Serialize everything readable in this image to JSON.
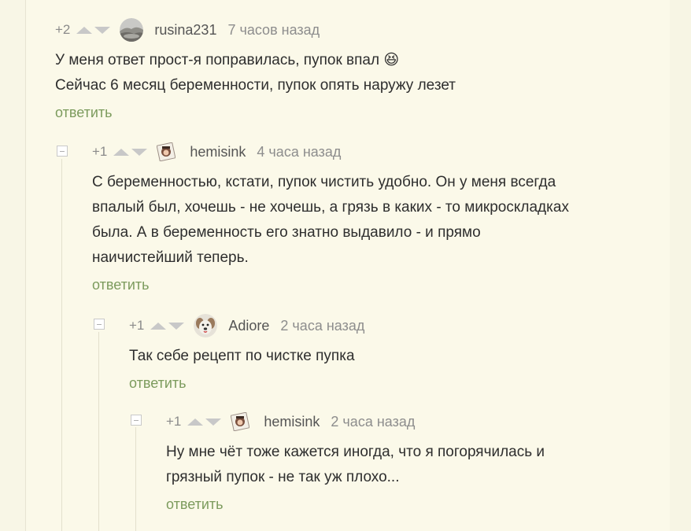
{
  "comments": [
    {
      "rating": "+2",
      "username": "rusina231",
      "time": "7 часов назад",
      "lines": [
        "У меня ответ прост-я поправилась, пупок впал 😆",
        "Сейчас 6 месяц беременности, пупок опять наружу лезет"
      ],
      "reply": "ответить",
      "avatar_icon": "landscape-avatar-icon"
    },
    {
      "rating": "+1",
      "username": "hemisink",
      "time": "4 часа назад",
      "lines": [
        "С беременностью, кстати, пупок чистить удобно. Он у меня всегда",
        "впалый был, хочешь - не хочешь, а грязь в каких - то микроскладках",
        "была. А в беременность его знатно выдавило - и прямо",
        "наичистейший теперь."
      ],
      "reply": "ответить",
      "avatar_icon": "cartoon-avatar-icon"
    },
    {
      "rating": "+1",
      "username": "Adiore",
      "time": "2 часа назад",
      "lines": [
        "Так себе рецепт по чистке пупка"
      ],
      "reply": "ответить",
      "avatar_icon": "dog-avatar-icon"
    },
    {
      "rating": "+1",
      "username": "hemisink",
      "time": "2 часа назад",
      "lines": [
        "Ну мне чёт тоже кажется иногда, что я погорячилась и",
        "грязный пупок - не так уж плохо..."
      ],
      "reply": "ответить",
      "avatar_icon": "cartoon-avatar-icon"
    }
  ],
  "colors": {
    "background": "#fbf9e9",
    "reply_link": "#7c9b5d",
    "text": "#2e2e2e",
    "muted": "#8d8d8d"
  }
}
